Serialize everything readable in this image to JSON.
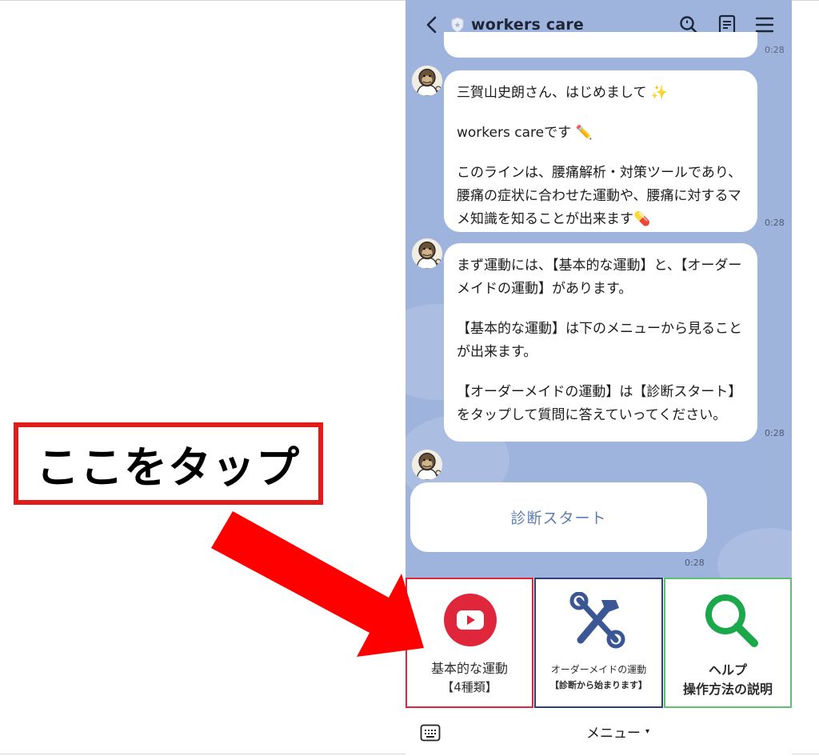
{
  "header": {
    "title": "workers care"
  },
  "chat": {
    "partial_time": "0:28",
    "messages": [
      {
        "paragraphs": [
          "三賀山史朗さん、はじめまして ✨",
          "workers careです ✏️",
          "このラインは、腰痛解析・対策ツールであり、腰痛の症状に合わせた運動や、腰痛に対するマメ知識を知ることが出来ます💊"
        ],
        "time": "0:28"
      },
      {
        "paragraphs": [
          "まず運動には、【基本的な運動】と、【オーダーメイドの運動】があります。",
          "【基本的な運動】は下のメニューから見ることが出来ます。",
          "【オーダーメイドの運動】は【診断スタート】をタップして質問に答えていってください。"
        ],
        "time": "0:28"
      }
    ],
    "action_button": {
      "label": "診断スタート",
      "time": "0:28"
    }
  },
  "rich_menu": {
    "tiles": [
      {
        "line1": "基本的な運動",
        "line2": "【4種類】",
        "border_color": "#e0263a",
        "icon": "youtube-play-icon"
      },
      {
        "line1": "オーダーメイドの運動",
        "line2": "【診断から始まります】",
        "border_color": "#2f3f7a",
        "icon": "tools-icon"
      },
      {
        "line1": "ヘルプ",
        "line2": "操作方法の説明",
        "border_color": "#5fbf72",
        "icon": "magnifier-icon"
      }
    ]
  },
  "bottom_bar": {
    "menu_label": "メニュー",
    "caret": "▾"
  },
  "annotation": {
    "label": "ここをタップ",
    "color": "#e21b1b"
  }
}
